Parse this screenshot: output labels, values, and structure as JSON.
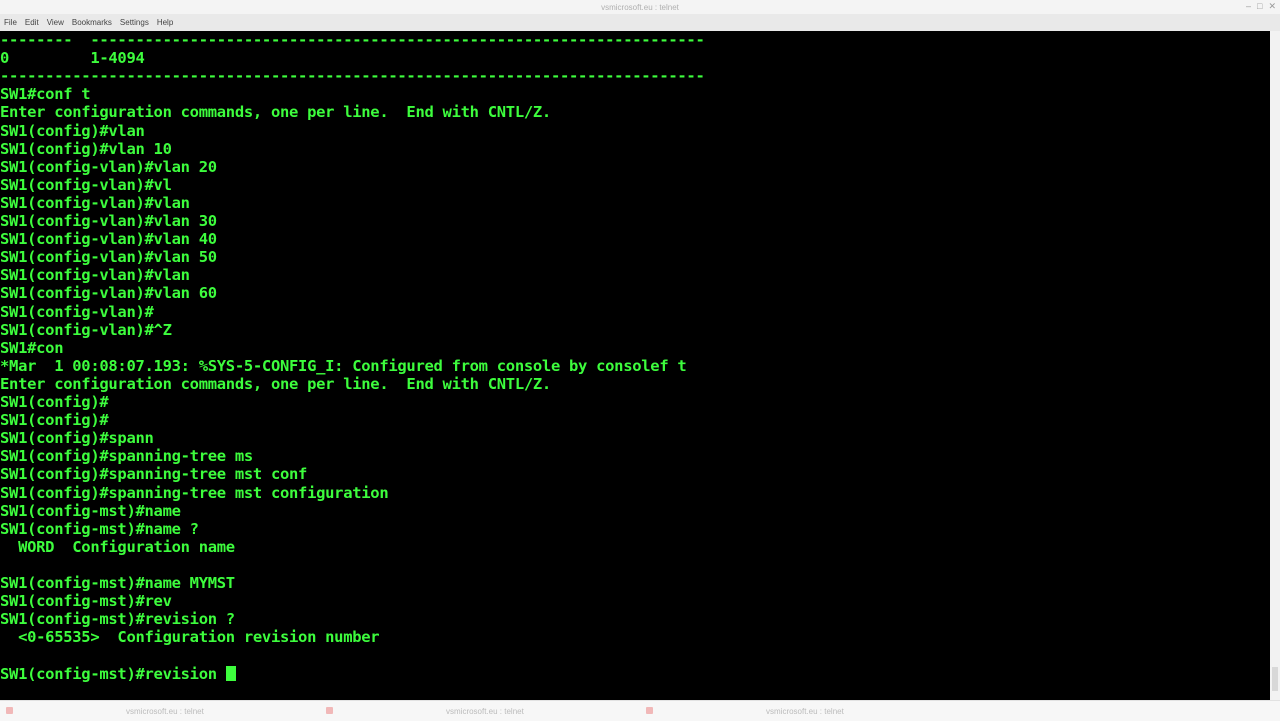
{
  "window": {
    "title": "vsmicrosoft.eu : telnet",
    "controls": [
      "–",
      "□",
      "✕"
    ]
  },
  "menu": [
    "File",
    "Edit",
    "View",
    "Bookmarks",
    "Settings",
    "Help"
  ],
  "terminal": {
    "lines": [
      "--------  --------------------------------------------------------------------",
      "0         1-4094",
      "------------------------------------------------------------------------------",
      "SW1#conf t",
      "Enter configuration commands, one per line.  End with CNTL/Z.",
      "SW1(config)#vlan",
      "SW1(config)#vlan 10",
      "SW1(config-vlan)#vlan 20",
      "SW1(config-vlan)#vl",
      "SW1(config-vlan)#vlan",
      "SW1(config-vlan)#vlan 30",
      "SW1(config-vlan)#vlan 40",
      "SW1(config-vlan)#vlan 50",
      "SW1(config-vlan)#vlan",
      "SW1(config-vlan)#vlan 60",
      "SW1(config-vlan)#",
      "SW1(config-vlan)#^Z",
      "SW1#con",
      "*Mar  1 00:08:07.193: %SYS-5-CONFIG_I: Configured from console by consolef t",
      "Enter configuration commands, one per line.  End with CNTL/Z.",
      "SW1(config)#",
      "SW1(config)#",
      "SW1(config)#spann",
      "SW1(config)#spanning-tree ms",
      "SW1(config)#spanning-tree mst conf",
      "SW1(config)#spanning-tree mst configuration",
      "SW1(config-mst)#name",
      "SW1(config-mst)#name ?",
      "  WORD  Configuration name",
      "",
      "SW1(config-mst)#name MYMST",
      "SW1(config-mst)#rev",
      "SW1(config-mst)#revision ?",
      "  <0-65535>  Configuration revision number",
      "",
      "SW1(config-mst)#revision "
    ],
    "text_color": "#3dfd3d",
    "background": "#000000"
  },
  "taskbar": [
    {
      "label": "vsmicrosoft.eu : telnet"
    },
    {
      "label": "vsmicrosoft.eu : telnet"
    },
    {
      "label": "vsmicrosoft.eu : telnet"
    }
  ]
}
